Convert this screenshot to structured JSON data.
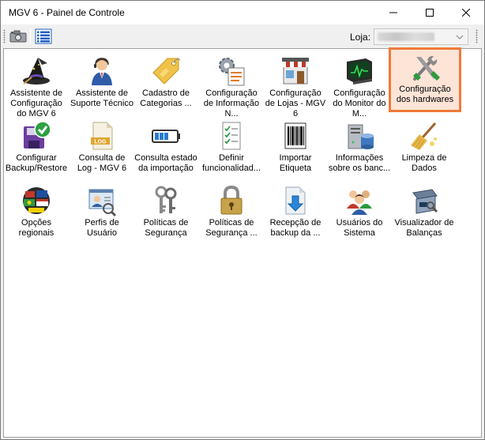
{
  "window": {
    "title": "MGV 6 - Painel de Controle"
  },
  "toolbar": {
    "loja_label": "Loja:",
    "loja_value": ""
  },
  "items": [
    {
      "id": "assistente-config",
      "label": "Assistente de Configuração do MGV 6",
      "icon": "wizard-hat-icon"
    },
    {
      "id": "assistente-suporte",
      "label": "Assistente de Suporte Técnico",
      "icon": "support-person-icon"
    },
    {
      "id": "cadastro-categorias",
      "label": "Cadastro de Categorias ...",
      "icon": "tag-icon"
    },
    {
      "id": "config-informacao",
      "label": "Configuração de Informação N...",
      "icon": "gear-document-icon"
    },
    {
      "id": "config-lojas",
      "label": "Configuração de Lojas - MGV 6",
      "icon": "store-icon"
    },
    {
      "id": "config-monitor",
      "label": "Configuração do Monitor do M...",
      "icon": "monitor-icon"
    },
    {
      "id": "config-hardwares",
      "label": "Configuração dos hardwares",
      "icon": "tools-icon"
    },
    {
      "id": "configurar-backup",
      "label": "Configurar Backup/Restore",
      "icon": "backup-check-icon"
    },
    {
      "id": "consulta-log",
      "label": "Consulta de Log - MGV 6",
      "icon": "log-file-icon"
    },
    {
      "id": "consulta-estado",
      "label": "Consulta estado da importação",
      "icon": "battery-icon"
    },
    {
      "id": "definir-funcionalidade",
      "label": "Definir funcionalidad...",
      "icon": "checklist-icon"
    },
    {
      "id": "importar-etiqueta",
      "label": "Importar Etiqueta",
      "icon": "barcode-icon"
    },
    {
      "id": "informacoes-banco",
      "label": "Informações sobre os banc...",
      "icon": "database-server-icon"
    },
    {
      "id": "limpeza-dados",
      "label": "Limpeza de Dados",
      "icon": "broom-icon"
    },
    {
      "id": "opcoes-regionais",
      "label": "Opções regionais",
      "icon": "flags-globe-icon"
    },
    {
      "id": "perfis-usuario",
      "label": "Perfis de Usuário",
      "icon": "user-profile-icon"
    },
    {
      "id": "politicas-seguranca",
      "label": "Políticas de Segurança",
      "icon": "keys-icon"
    },
    {
      "id": "politicas-seguranca-2",
      "label": "Políticas de Segurança ...",
      "icon": "padlock-icon"
    },
    {
      "id": "recepcao-backup",
      "label": "Recepção de backup da ...",
      "icon": "download-file-icon"
    },
    {
      "id": "usuarios-sistema",
      "label": "Usuários do Sistema",
      "icon": "users-group-icon"
    },
    {
      "id": "visualizador-balancas",
      "label": "Visualizador de Balanças",
      "icon": "scale-icon"
    }
  ],
  "selected_item": "config-hardwares",
  "colors": {
    "selection_border": "#f07a3a",
    "selection_fill": "#fde4d7"
  }
}
